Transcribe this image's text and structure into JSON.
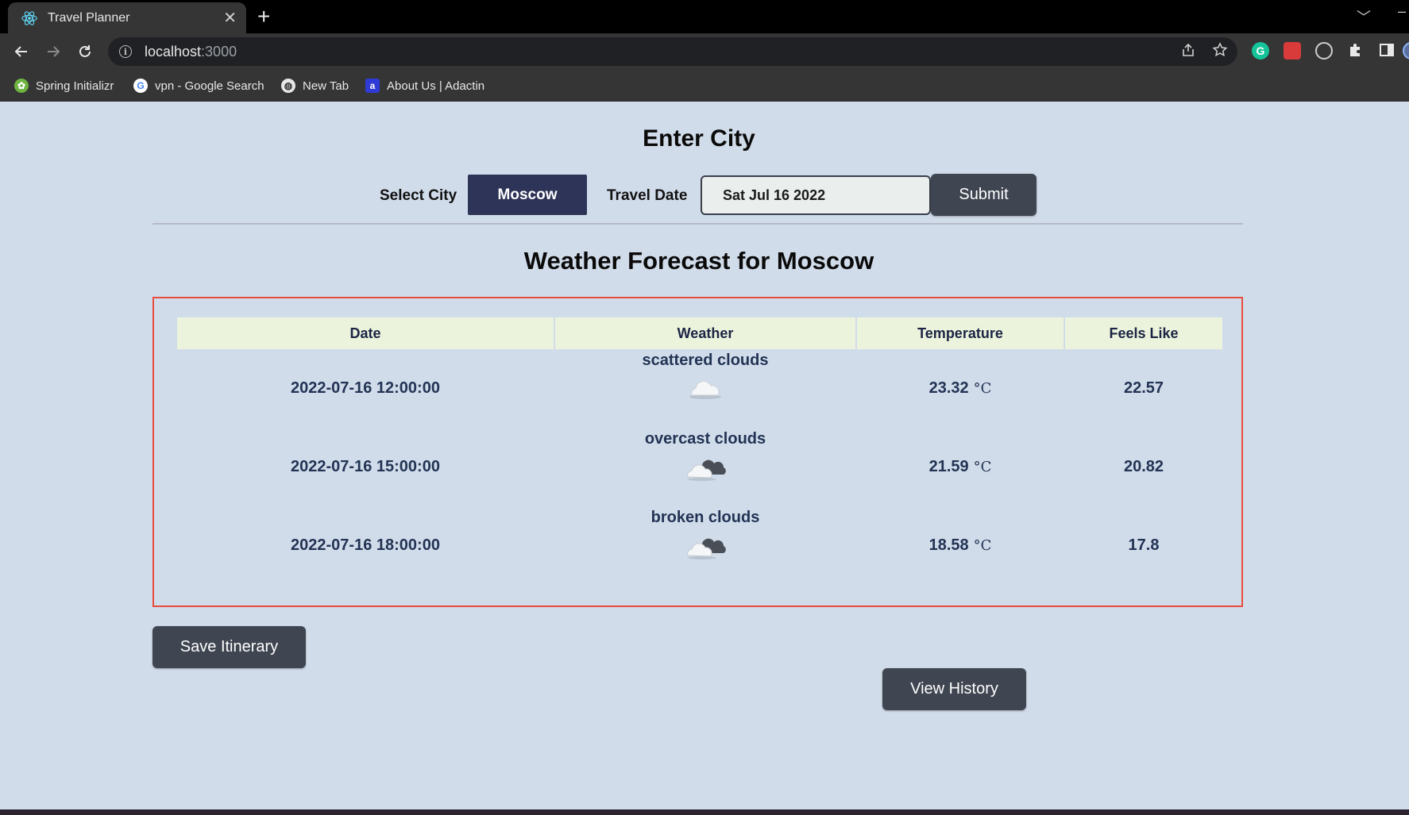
{
  "browser": {
    "tab_title": "Travel Planner",
    "url_host": "localhost",
    "url_port": ":3000",
    "bookmarks": [
      {
        "label": "Spring Initializr",
        "icon": "spring-icon"
      },
      {
        "label": "vpn - Google Search",
        "icon": "google-icon"
      },
      {
        "label": "New Tab",
        "icon": "globe-icon"
      },
      {
        "label": "About Us | Adactin",
        "icon": "adactin-icon"
      }
    ]
  },
  "form": {
    "heading": "Enter City",
    "select_city_label": "Select City",
    "selected_city": "Moscow",
    "travel_date_label": "Travel Date",
    "travel_date_value": "Sat Jul 16 2022",
    "submit_label": "Submit"
  },
  "forecast": {
    "title": "Weather Forecast for Moscow",
    "columns": [
      "Date",
      "Weather",
      "Temperature",
      "Feels Like"
    ],
    "temp_unit": "°C",
    "rows": [
      {
        "date": "2022-07-16 12:00:00",
        "weather": "scattered clouds",
        "icon": "scattered-clouds-icon",
        "temperature": "23.32",
        "feels_like": "22.57"
      },
      {
        "date": "2022-07-16 15:00:00",
        "weather": "overcast clouds",
        "icon": "overcast-clouds-icon",
        "temperature": "21.59",
        "feels_like": "20.82"
      },
      {
        "date": "2022-07-16 18:00:00",
        "weather": "broken clouds",
        "icon": "broken-clouds-icon",
        "temperature": "18.58",
        "feels_like": "17.8"
      }
    ]
  },
  "actions": {
    "save_label": "Save Itinerary",
    "history_label": "View History"
  },
  "colors": {
    "page_bg": "#d1dcea",
    "city_select_bg": "#2e3457",
    "button_bg": "#3f4651",
    "table_header_bg": "#ecf3dc",
    "forecast_border": "#e74c3c",
    "cell_text": "#223354"
  }
}
